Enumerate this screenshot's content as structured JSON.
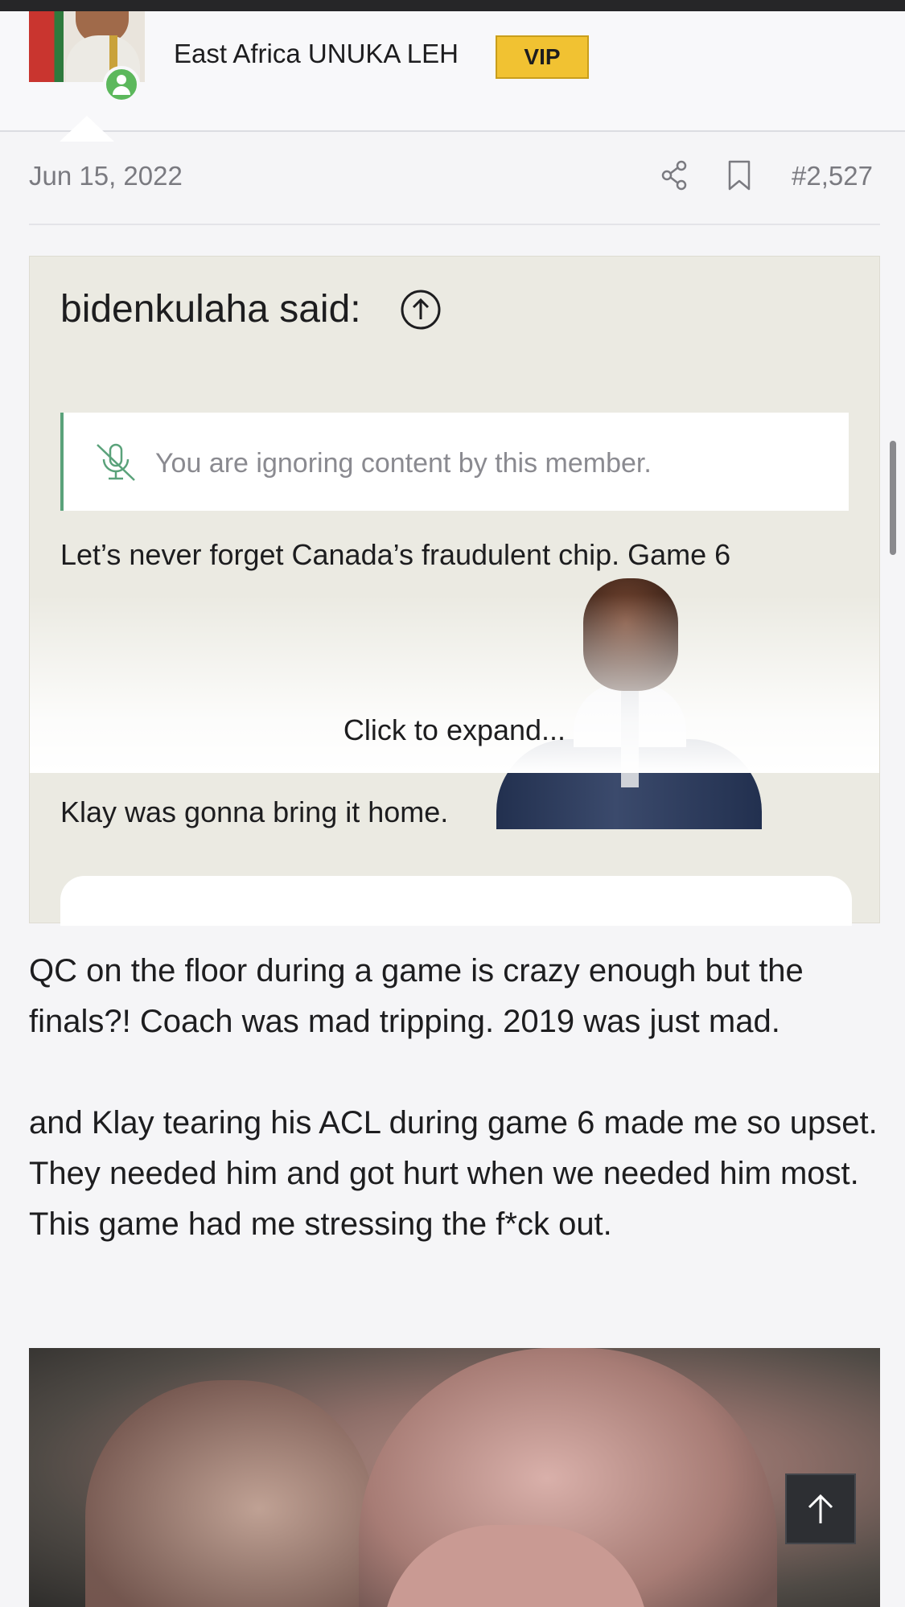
{
  "author": {
    "title": "East Africa UNUKA LEH",
    "badge": "VIP"
  },
  "post": {
    "date": "Jun 15, 2022",
    "number": "#2,527",
    "quote": {
      "author": "bidenkulaha said:",
      "ignored_notice": "You are ignoring content by this member.",
      "line1": "Let’s never forget Canada’s fraudulent chip. Game 6",
      "expand_label": "Click to expand...",
      "line2": "Klay was gonna bring it home."
    },
    "body": {
      "p1": "QC on the floor during a game is crazy enough but the finals?! Coach was mad tripping. 2019 was just mad.",
      "p2": "and Klay tearing his ACL during game 6 made me so upset. They needed him and got hurt when we needed him most.",
      "p3": "This game had me stressing the f*ck out."
    }
  },
  "icons": {
    "share": "share-icon",
    "bookmark": "bookmark-icon",
    "goto": "arrow-up-circle-icon",
    "ignore": "muted-mic-icon",
    "back_to_top": "arrow-up-icon",
    "online": "user-online-icon"
  },
  "colors": {
    "vip_badge": "#f1c232",
    "online": "#5cb85c",
    "quote_bg": "#ebeae2",
    "ignore_border": "#5aa27a"
  }
}
